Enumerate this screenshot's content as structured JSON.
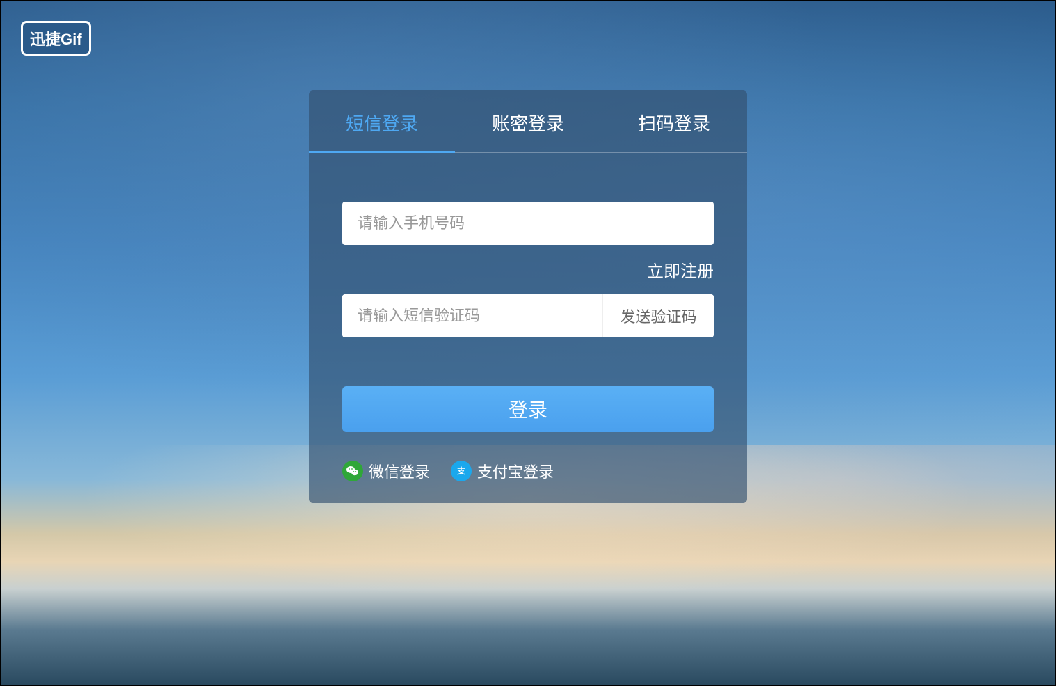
{
  "logo": {
    "text": "迅捷Gif"
  },
  "tabs": {
    "sms": "短信登录",
    "password": "账密登录",
    "qrcode": "扫码登录"
  },
  "form": {
    "phone_placeholder": "请输入手机号码",
    "register_link": "立即注册",
    "code_placeholder": "请输入短信验证码",
    "send_code_label": "发送验证码",
    "login_button": "登录"
  },
  "alt_login": {
    "wechat": "微信登录",
    "alipay": "支付宝登录"
  }
}
